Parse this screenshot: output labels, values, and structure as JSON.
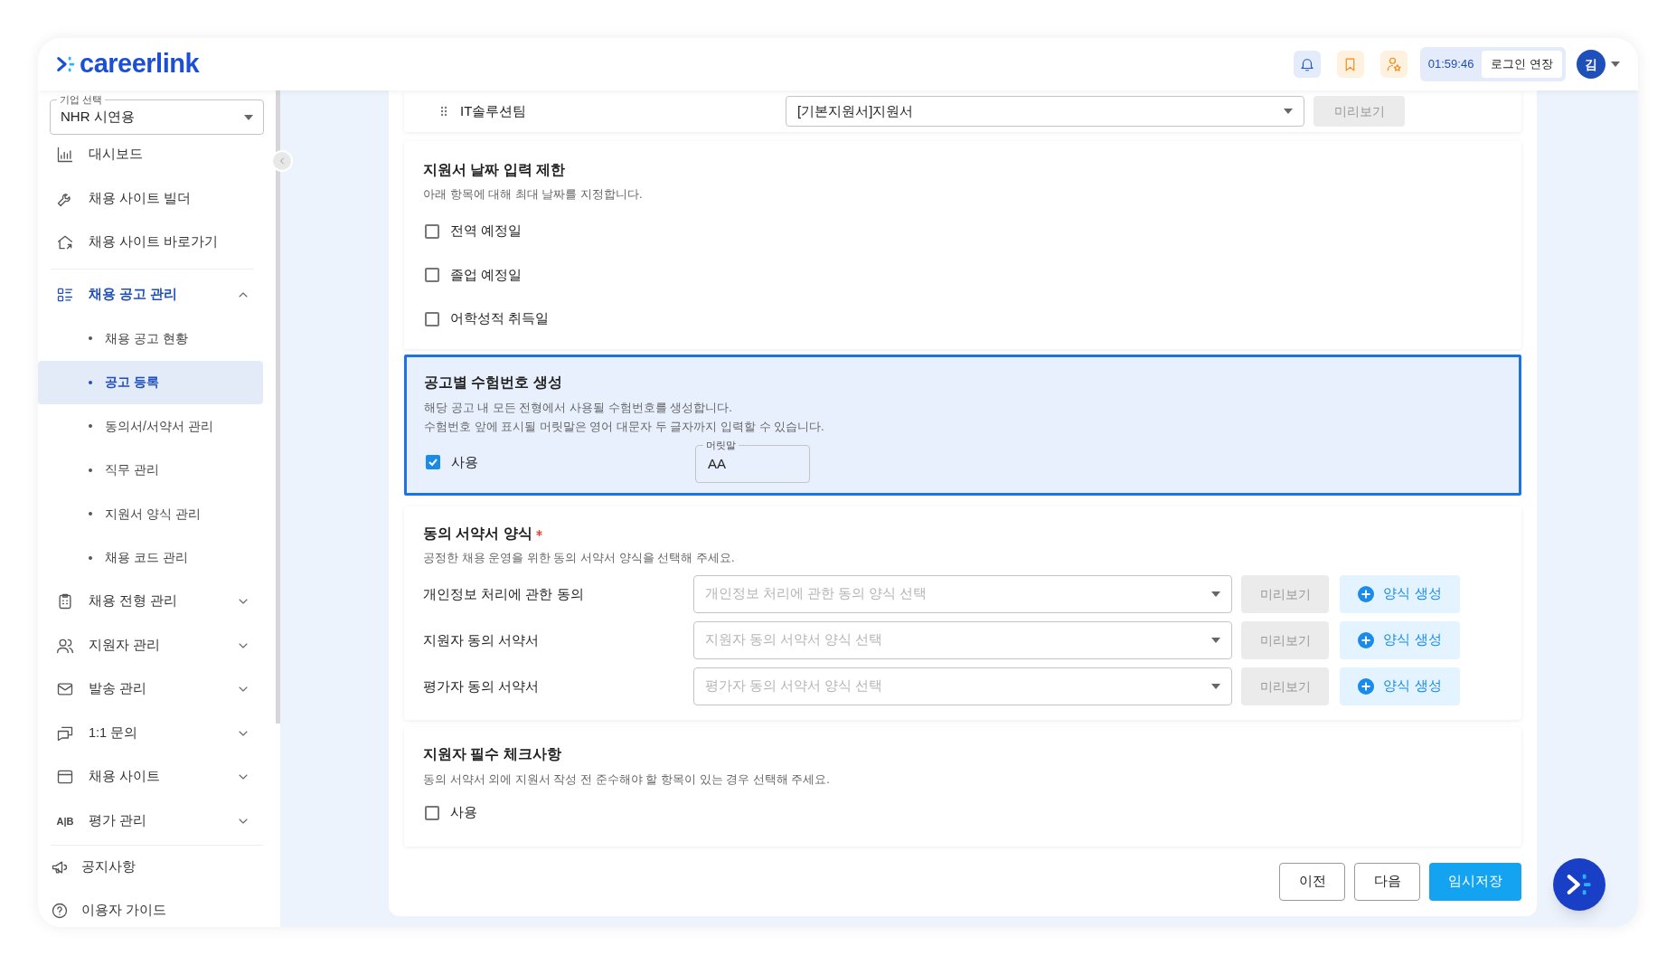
{
  "header": {
    "logo": "careerlink",
    "timer": "01:59:46",
    "extend_button": "로그인 연장",
    "avatar": "김"
  },
  "sidebar": {
    "company_select": {
      "label": "기업 선택",
      "value": "NHR 시연용"
    },
    "links": [
      {
        "label": "대시보드"
      },
      {
        "label": "채용 사이트 빌더"
      },
      {
        "label": "채용 사이트 바로가기"
      }
    ],
    "groups": [
      {
        "label": "채용 공고 관리",
        "expanded": true,
        "children": [
          {
            "label": "채용 공고 현황",
            "selected": false
          },
          {
            "label": "공고 등록",
            "selected": true
          },
          {
            "label": "동의서/서약서 관리",
            "selected": false
          },
          {
            "label": "직무 관리",
            "selected": false
          },
          {
            "label": "지원서 양식 관리",
            "selected": false
          },
          {
            "label": "채용 코드 관리",
            "selected": false
          }
        ]
      },
      {
        "label": "채용 전형 관리",
        "expanded": false
      },
      {
        "label": "지원자 관리",
        "expanded": false
      },
      {
        "label": "발송 관리",
        "expanded": false
      },
      {
        "label": "1:1 문의",
        "expanded": false
      },
      {
        "label": "채용 사이트",
        "expanded": false
      },
      {
        "label": "평가 관리",
        "expanded": false,
        "icon_text": "A|B"
      }
    ],
    "footer": [
      {
        "label": "공지사항"
      },
      {
        "label": "이용자 가이드"
      }
    ]
  },
  "top_row": {
    "name": "IT솔루션팀",
    "form": "[기본지원서]지원서",
    "preview": "미리보기"
  },
  "date_limit": {
    "title": "지원서 날짜 입력 제한",
    "description": "아래 항목에 대해 최대 날짜를 지정합니다.",
    "options": [
      {
        "label": "전역 예정일",
        "checked": false
      },
      {
        "label": "졸업 예정일",
        "checked": false
      },
      {
        "label": "어학성적 취득일",
        "checked": false
      }
    ]
  },
  "exam_number": {
    "highlighted": true,
    "title": "공고별 수험번호 생성",
    "descriptions": [
      "해당 공고 내 모든 전형에서 사용될 수험번호를 생성합니다.",
      "수험번호 앞에 표시될 머릿말은 영어 대문자 두 글자까지 입력할 수 있습니다."
    ],
    "use": {
      "label": "사용",
      "checked": true
    },
    "prefix": {
      "label": "머릿말",
      "value": "AA"
    }
  },
  "consent_forms": {
    "title": "동의 서약서 양식",
    "required": true,
    "description": "공정한 채용 운영을 위한 동의 서약서 양식을 선택해 주세요.",
    "rows": [
      {
        "label": "개인정보 처리에 관한 동의",
        "placeholder": "개인정보 처리에 관한 동의 양식 선택",
        "preview": "미리보기",
        "create": "양식 생성"
      },
      {
        "label": "지원자 동의 서약서",
        "placeholder": "지원자 동의 서약서 양식 선택",
        "preview": "미리보기",
        "create": "양식 생성"
      },
      {
        "label": "평가자 동의 서약서",
        "placeholder": "평가자 동의 서약서 양식 선택",
        "preview": "미리보기",
        "create": "양식 생성"
      }
    ]
  },
  "required_checks": {
    "title": "지원자 필수 체크사항",
    "description": "동의 서약서 외에 지원서 작성 전 준수해야 할 항목이 있는 경우 선택해 주세요.",
    "use": {
      "label": "사용",
      "checked": false
    }
  },
  "buttons": [
    {
      "label": "이전",
      "kind": "outline"
    },
    {
      "label": "다음",
      "kind": "outline"
    },
    {
      "label": "임시저장",
      "kind": "primary"
    }
  ]
}
